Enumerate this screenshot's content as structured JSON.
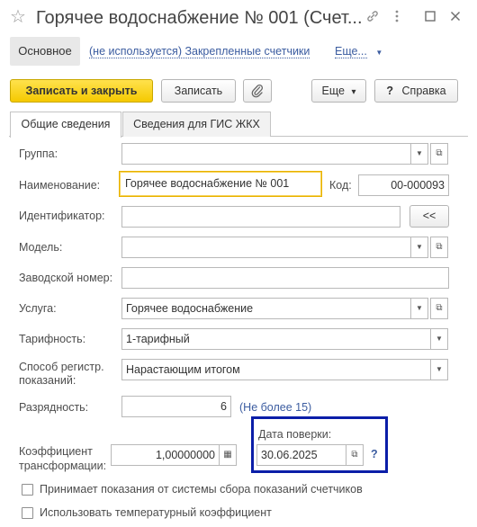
{
  "window": {
    "title": "Горячее водоснабжение № 001 (Счет...",
    "icons": {
      "star": "star-icon",
      "link": "link-icon",
      "more": "more-vertical-icon",
      "maximize": "maximize-icon",
      "close": "close-icon"
    }
  },
  "nav": {
    "main_tab": "Основное",
    "link_unused": "(не используется) Закрепленные счетчики",
    "more": "Еще...",
    "more_arrow": "▼"
  },
  "toolbar": {
    "save_close": "Записать и закрыть",
    "save": "Записать",
    "attach_icon": "paperclip-icon",
    "more": "Еще",
    "more_arrow": "▾",
    "help_mark": "?",
    "help": "Справка"
  },
  "tabs": [
    {
      "label": "Общие сведения",
      "active": true
    },
    {
      "label": "Сведения для ГИС ЖКХ",
      "active": false
    }
  ],
  "form": {
    "group_label": "Группа:",
    "group_value": "",
    "name_label": "Наименование:",
    "name_value": "Горячее водоснабжение № 001",
    "code_label": "Код:",
    "code_value": "00-000093",
    "id_label": "Идентификатор:",
    "id_value": "",
    "id_button": "<<",
    "model_label": "Модель:",
    "model_value": "",
    "serial_label": "Заводской номер:",
    "serial_value": "",
    "service_label": "Услуга:",
    "service_value": "Горячее водоснабжение",
    "tariff_label": "Тарифность:",
    "tariff_value": "1-тарифный",
    "method_label_1": "Способ регистр.",
    "method_label_2": "показаний:",
    "method_value": "Нарастающим итогом",
    "digits_label": "Разрядность:",
    "digits_value": "6",
    "digits_hint": "(Не более 15)",
    "coef_label_1": "Коэффициент",
    "coef_label_2": "трансформации:",
    "coef_value": "1,00000000",
    "check_date_label": "Дата поверки:",
    "check_date_value": "30.06.2025",
    "check_date_help": "?",
    "cb1_label": "Принимает показания от системы сбора показаний счетчиков",
    "cb1_checked": false,
    "cb2_label": "Использовать температурный коэффициент",
    "cb2_checked": false
  },
  "colors": {
    "accent_yellow": "#f5c900",
    "link": "#3b5ca0",
    "highlight": "#0b1ea8"
  },
  "glyphs": {
    "dropdown": "▼",
    "open": "⧉",
    "calc": "▦"
  }
}
